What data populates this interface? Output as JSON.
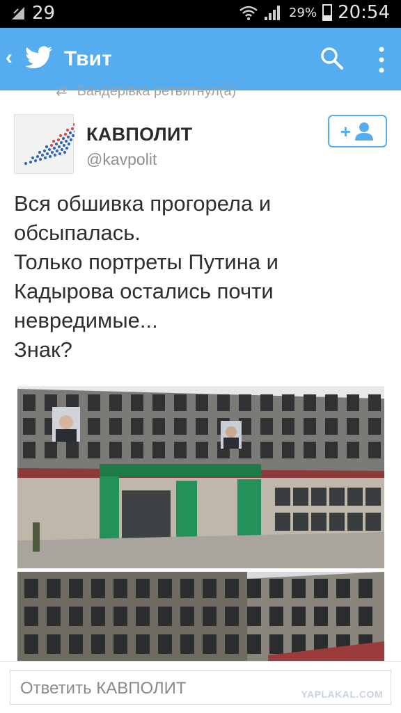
{
  "status_bar": {
    "notification_count": "29",
    "battery_percent": "29%",
    "time": "20:54",
    "icons": [
      "signal-icon",
      "wifi-icon",
      "cell-signal-icon",
      "battery-icon"
    ]
  },
  "app_bar": {
    "back_icon": "chevron-left-icon",
    "logo": "twitter-bird-icon",
    "title": "Твит",
    "actions": [
      "search-icon",
      "more-vert-icon"
    ],
    "background": "#55acee"
  },
  "retweet": {
    "text": "Бандерівка ретвитнул(а)",
    "icon": "retweet-icon"
  },
  "author": {
    "name": "КАВПОЛИТ",
    "handle": "@kavpolit",
    "follow_icon": "add-user-icon",
    "follow_label": "+"
  },
  "tweet": {
    "lines": [
      "Вся обшивка прогорела и",
      "обсыпалась.",
      "Только портреты Путина и",
      "Кадырова остались почти",
      "невредимые...",
      "Знак?"
    ]
  },
  "media": {
    "photo_count": 2
  },
  "reply": {
    "placeholder": "Ответить КАВПОЛИТ"
  },
  "watermark": "YAPLAKAL.COM"
}
